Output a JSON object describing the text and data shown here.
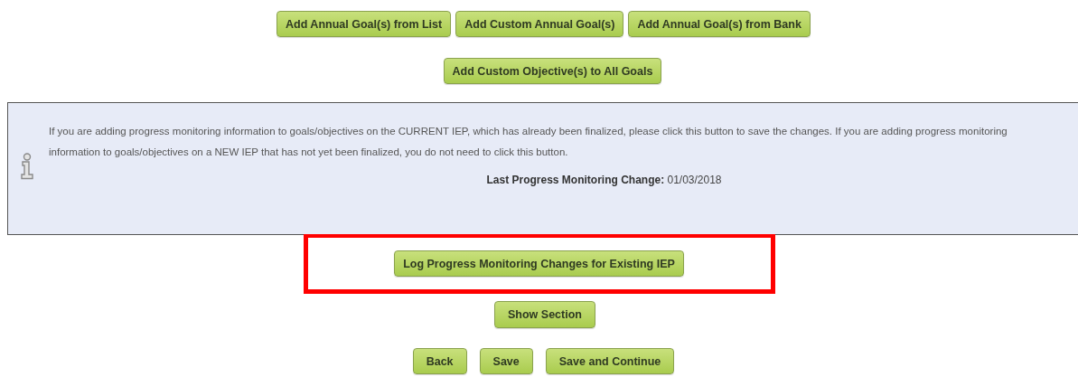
{
  "goal_buttons": [
    "Add Annual Goal(s) from List",
    "Add Custom Annual Goal(s)",
    "Add Annual Goal(s) from Bank"
  ],
  "objective_button": "Add Custom Objective(s) to All Goals",
  "info_panel": {
    "message": "If you are adding progress monitoring information to goals/objectives on the CURRENT IEP, which has already been finalized, please click this button to save the changes. If you are adding progress monitoring information to goals/objectives on a NEW IEP that has not yet been finalized, you do not need to click this button.",
    "last_change_label": "Last Progress Monitoring Change:",
    "last_change_date": "01/03/2018"
  },
  "log_button": {
    "label": "Log Progress Monitoring Changes for Existing IEP",
    "highlighted": true
  },
  "show_section_button": "Show Section",
  "footer_buttons": [
    "Back",
    "Save",
    "Save and Continue"
  ]
}
